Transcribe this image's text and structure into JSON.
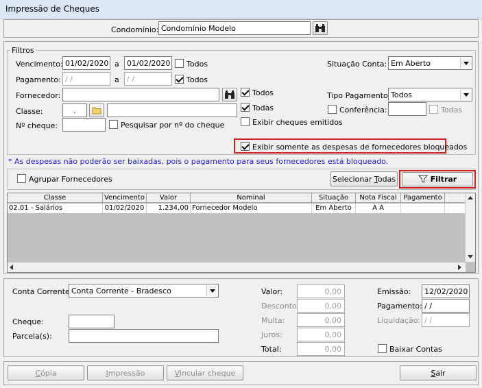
{
  "window": {
    "title": "Impressão de Cheques"
  },
  "header": {
    "condominio_label": "Condomínio:",
    "condominio_value": "Condomínio Modelo"
  },
  "filtros": {
    "legend": "Filtros",
    "vencimento_label": "Vencimento:",
    "vencimento_from": "01/02/2020",
    "vencimento_sep": "a",
    "vencimento_to": "01/02/2020",
    "vencimento_todos": "Todos",
    "pagamento_label": "Pagamento:",
    "pagamento_from": " / /",
    "pagamento_sep": "a",
    "pagamento_to": " / /",
    "pagamento_todos": "Todos",
    "fornecedor_label": "Fornecedor:",
    "fornecedor_todos": "Todos",
    "classe_label": "Classe:",
    "classe_code": ".",
    "classe_todas": "Todas",
    "cheque_label": "Nº cheque:",
    "pesquisar_label": "Pesquisar por nº do cheque",
    "exibir_emitidos": "Exibir cheques emitidos",
    "situacao_label": "Situação Conta:",
    "situacao_value": "Em Aberto",
    "tipo_label": "Tipo Pagamento:",
    "tipo_value": "Todos",
    "conferencia_label": "Conferência:",
    "conferencia_todas": "Todas",
    "bloqueados_label": "Exibir somente as despesas de fornecedores bloqueados"
  },
  "note": "* As despesas não poderão ser baixadas, pois o pagamento para seus fornecedores está bloqueado.",
  "actions": {
    "agrupar_label": "Agrupar Fornecedores",
    "selecionar_pre": "Selecionar ",
    "selecionar_u": "T",
    "selecionar_post": "odas",
    "filtrar_label": "Filtrar"
  },
  "table": {
    "columns": [
      "Classe",
      "Vencimento",
      "Valor",
      "Nominal",
      "Situação",
      "Nota Fiscal",
      "Pagamento"
    ],
    "rows": [
      {
        "classe": "02.01 - Salários",
        "vencimento": "01/02/2020",
        "valor": "1.234,00",
        "nominal": "Fornecedor Modelo",
        "situacao": "Em Aberto",
        "nota": "A A",
        "pagamento": ""
      }
    ]
  },
  "footer": {
    "conta_label": "Conta Corrente:",
    "conta_value": "Conta Corrente - Bradesco",
    "cheque_label": "Cheque:",
    "parcela_label": "Parcela(s):",
    "valor_label": "Valor:",
    "valor": "0,00",
    "desconto_label": "Desconto:",
    "desconto": "0,00",
    "multa_label": "Multa:",
    "multa": "0,00",
    "juros_label": "Juros:",
    "juros": "0,00",
    "total_label": "Total:",
    "total": "0,00",
    "emissao_label": "Emissão:",
    "emissao": "12/02/2020",
    "pagamento_label": "Pagamento:",
    "pagamento": " / /",
    "liquidacao_label": "Liquidação:",
    "liquidacao": " / /",
    "baixar_label": "Baixar Contas"
  },
  "buttons": {
    "copia_u": "C",
    "copia_rest": "ópia",
    "impressao_u": "I",
    "impressao_rest": "mpressão",
    "vincular_u": "V",
    "vincular_rest": "incular cheque",
    "sair_u": "S",
    "sair_rest": "air"
  },
  "colors": {
    "highlight_border": "#d01f1f",
    "note_text": "#1c1cc8"
  }
}
